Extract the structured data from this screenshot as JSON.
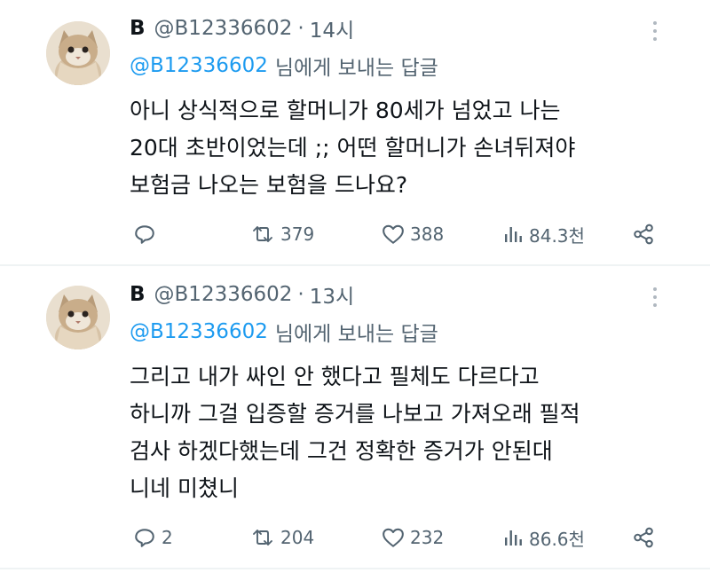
{
  "tweets": [
    {
      "display_name": "B",
      "handle": "@B12336602",
      "separator": "·",
      "time": "14시",
      "reply_to_handle": "@B12336602",
      "reply_to_suffix": "님에게 보내는 답글",
      "body_lines": [
        "아니 상식적으로 할머니가 80세가 넘었고 나는",
        "20대 초반이었는데 ;; 어떤 할머니가 손녀뒤져야",
        "보험금 나오는 보험을 드나요?"
      ],
      "actions": {
        "reply_icon": "reply-icon",
        "reply_count": "",
        "retweet_icon": "retweet-icon",
        "retweet_count": "379",
        "like_icon": "heart-icon",
        "like_count": "388",
        "views_icon": "bar-chart-icon",
        "views_count": "84.3천",
        "share_icon": "share-icon"
      }
    },
    {
      "display_name": "B",
      "handle": "@B12336602",
      "separator": "·",
      "time": "13시",
      "reply_to_handle": "@B12336602",
      "reply_to_suffix": "님에게 보내는 답글",
      "body_lines": [
        "그리고 내가 싸인 안 했다고 필체도 다르다고",
        "하니까 그걸 입증할 증거를 나보고 가져오래 필적",
        "검사 하겠다했는데 그건 정확한 증거가 안된대",
        "니네 미쳤니"
      ],
      "actions": {
        "reply_icon": "reply-icon",
        "reply_count": "2",
        "retweet_icon": "retweet-icon",
        "retweet_count": "204",
        "like_icon": "heart-icon",
        "like_count": "232",
        "views_icon": "bar-chart-icon",
        "views_count": "86.6천",
        "share_icon": "share-icon"
      }
    }
  ],
  "colors": {
    "mention": "#1d9bf0",
    "muted": "#536471",
    "text": "#0f1419",
    "divider": "#eff3f4"
  }
}
